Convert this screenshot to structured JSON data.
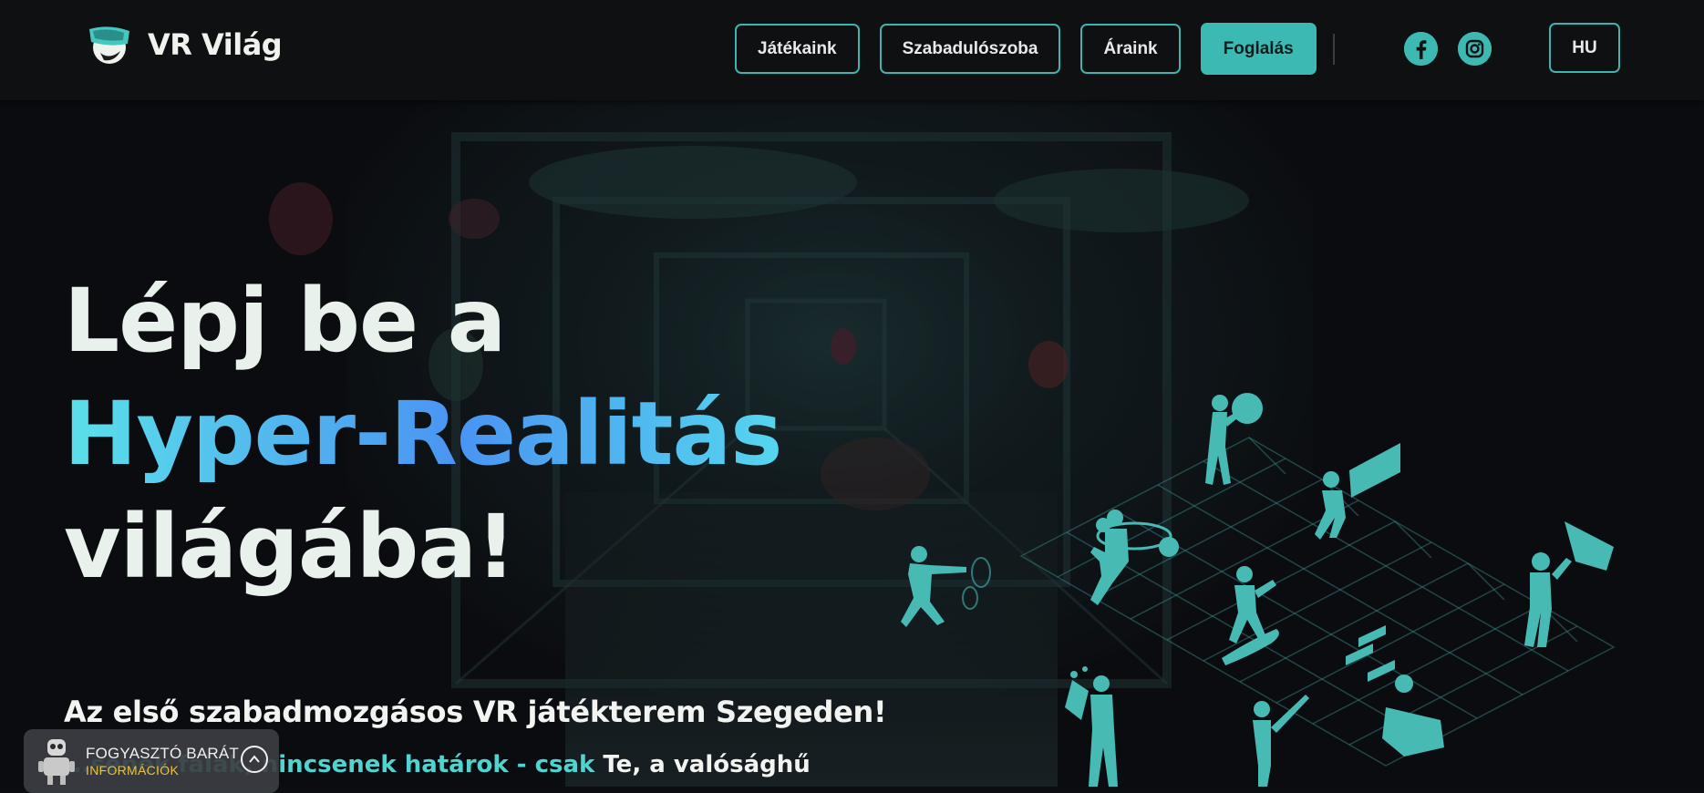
{
  "header": {
    "logo_text": "VR Világ",
    "nav": [
      {
        "label": "Játékaink"
      },
      {
        "label": "Szabadulószoba"
      },
      {
        "label": "Áraink"
      },
      {
        "label": "Foglalás"
      }
    ],
    "social": [
      {
        "icon": "facebook-icon"
      },
      {
        "icon": "instagram-icon"
      }
    ],
    "language": "HU"
  },
  "hero": {
    "headline_line1": "Lépj be a",
    "headline_accent": "Hyper-Realitás",
    "headline_line3": "világába!",
    "subtitle": "Az első szabadmozgásos VR játékterem Szegeden!",
    "tagline_part1": "...senek falak, nincsenek határok - csak",
    "tagline_part2": "Te",
    "tagline_part3": ", a valósághű"
  },
  "accessibility": {
    "title": "FOGYASZTÓ BARÁT",
    "subtitle": "INFORMÁCIÓK",
    "toggle_icon": "chevron-up-icon"
  },
  "colors": {
    "accent": "#3cb9b3",
    "gradient_start": "#5be0ea",
    "gradient_mid": "#4a94f2",
    "background": "#0b0d10"
  }
}
